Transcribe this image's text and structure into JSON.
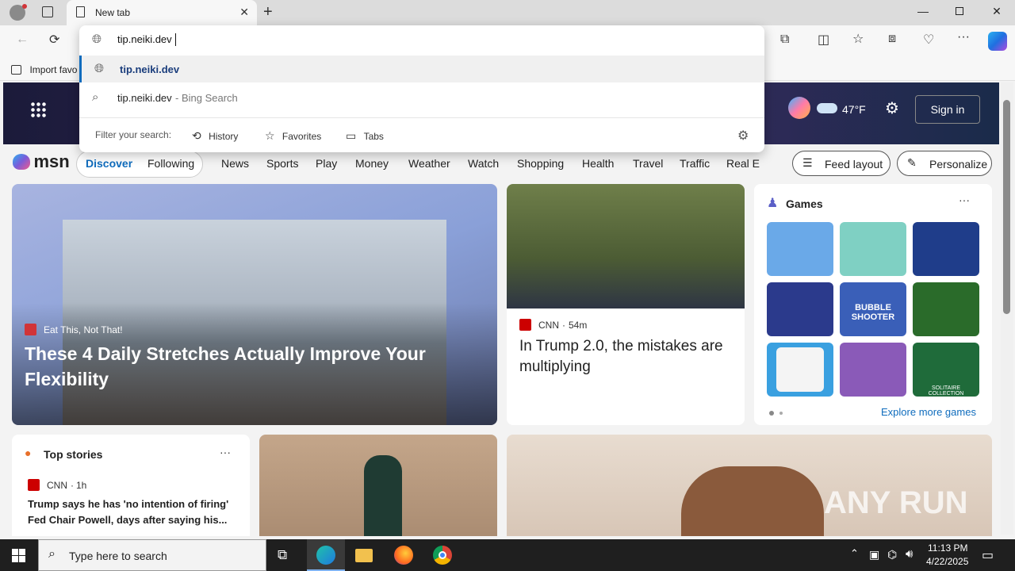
{
  "browser": {
    "tab_title": "New tab",
    "address_value": "tip.neiki.dev",
    "favorites_bar_item": "Import favo"
  },
  "omnibox": {
    "suggestions": [
      {
        "icon": "globe-icon",
        "text": "tip.neiki.dev",
        "suffix": ""
      },
      {
        "icon": "search-icon",
        "text": "tip.neiki.dev",
        "suffix": " - Bing Search"
      }
    ],
    "filter_label": "Filter your search:",
    "filters": [
      "History",
      "Favorites",
      "Tabs"
    ]
  },
  "msn_header": {
    "weather_temp": "47°F",
    "sign_in": "Sign in"
  },
  "msn_nav": {
    "logo": "msn",
    "items": [
      "Discover",
      "Following",
      "News",
      "Sports",
      "Play",
      "Money",
      "Weather",
      "Watch",
      "Shopping",
      "Health",
      "Travel",
      "Traffic",
      "Real E"
    ],
    "feed_layout": "Feed layout",
    "personalize": "Personalize"
  },
  "hero": {
    "source": "Eat This, Not That!",
    "headline": "These 4 Daily Stretches Actually Improve Your Flexibility"
  },
  "cnn_card": {
    "source": "CNN",
    "time": "54m",
    "headline": "In Trump 2.0, the mistakes are multiplying"
  },
  "games": {
    "title": "Games",
    "explore": "Explore more games",
    "tiles": [
      {
        "name": "game-tile-1",
        "color": "#6aa9e8"
      },
      {
        "name": "game-tile-2",
        "color": "#7fd0c3"
      },
      {
        "name": "game-tile-3",
        "color": "#1f3d8a"
      },
      {
        "name": "game-tile-4",
        "color": "#2b3a8c"
      },
      {
        "name": "game-tile-5",
        "color": "#3a5fb8"
      },
      {
        "name": "game-tile-6",
        "color": "#2a6b2a"
      },
      {
        "name": "game-tile-7",
        "color": "#3aa0e0"
      },
      {
        "name": "game-tile-8",
        "color": "#8a5ab8"
      },
      {
        "name": "game-tile-9",
        "color": "#1f6b3a"
      }
    ],
    "bubble_label": "BUBBLE SHOOTER",
    "solitaire_label": "SOLITAIRE COLLECTION"
  },
  "top_stories": {
    "title": "Top stories",
    "source": "CNN",
    "time": "1h",
    "headline": "Trump says he has 'no intention of firing' Fed Chair Powell, days after saying his..."
  },
  "taskbar": {
    "search_placeholder": "Type here to search",
    "time": "11:13 PM",
    "date": "4/22/2025"
  },
  "watermark": "ANY RUN"
}
